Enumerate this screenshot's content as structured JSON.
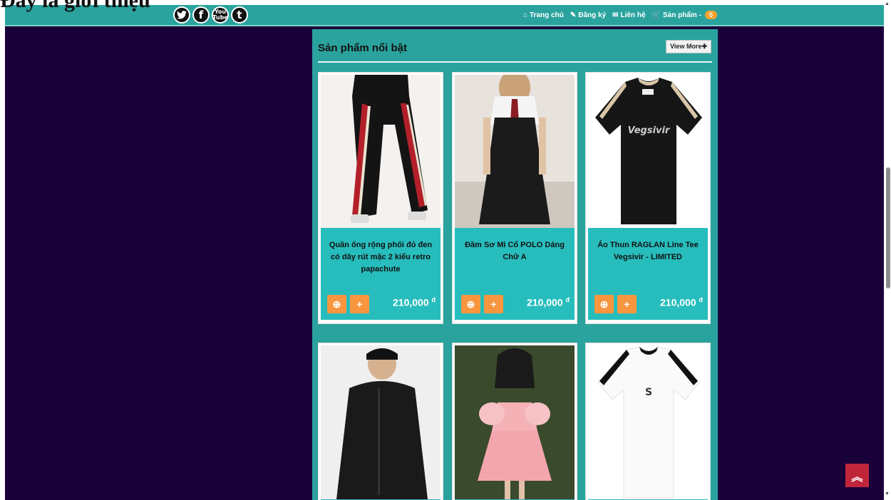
{
  "clipped_heading": "Đây là giới thiệu",
  "social": [
    {
      "name": "twitter-icon",
      "glyph": "🐦"
    },
    {
      "name": "facebook-icon",
      "glyph": "f"
    },
    {
      "name": "youtube-icon",
      "glyph": "You Tube"
    },
    {
      "name": "tumblr-icon",
      "glyph": "t"
    }
  ],
  "nav": {
    "home": "Trang chủ",
    "register": "Đăng ký",
    "contact": "Liên hệ",
    "products": "Sản phẩm -",
    "cart_count": "0"
  },
  "panel": {
    "title": "Sản phẩm nổi bật",
    "view_more": "View More"
  },
  "products": [
    {
      "name": "Quần ống rộng phối đỏ đen có dây rút mặc 2 kiểu retro papachute",
      "price": "210,000",
      "currency": "đ"
    },
    {
      "name": "Đầm Sơ Mi Cổ POLO Dáng Chữ A",
      "price": "210,000",
      "currency": "đ"
    },
    {
      "name": "Áo Thun RAGLAN Line Tee Vegsivir - LIMITED",
      "price": "210,000",
      "currency": "đ"
    }
  ],
  "colors": {
    "teal": "#2aa39e",
    "card_info": "#28bdbd",
    "orange": "#f7963f",
    "background": "#1a0039",
    "back_to_top": "#c0263a"
  }
}
